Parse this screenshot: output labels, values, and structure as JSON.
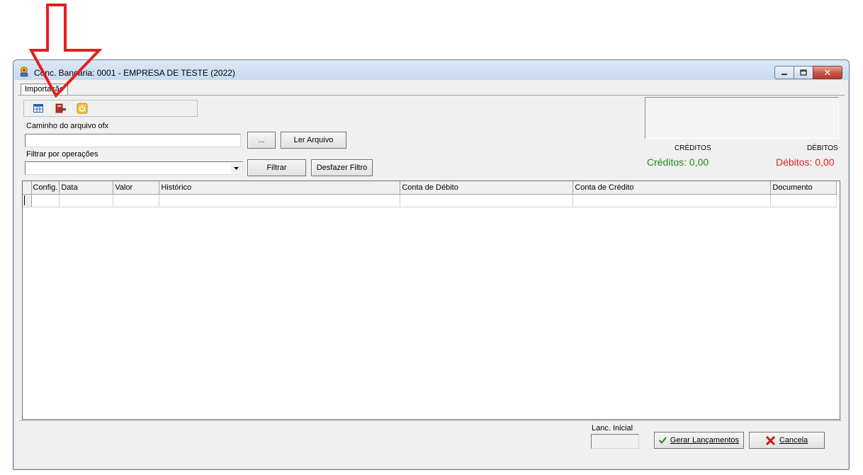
{
  "window": {
    "title": "Conc. Bancária: 0001 - EMPRESA DE TESTE (2022)",
    "controls": {
      "minimize": "minimize",
      "maximize": "maximize",
      "close": "✕"
    }
  },
  "tabs": [
    {
      "label": "Importação"
    }
  ],
  "toolbar": {
    "icons": [
      "grid-icon",
      "import-ofx-icon",
      "power-icon"
    ]
  },
  "import": {
    "path_label": "Caminho do arquivo ofx",
    "path_value": "",
    "browse_label": "...",
    "read_label": "Ler Arquivo"
  },
  "filter": {
    "label": "Filtrar por operações",
    "selected": "",
    "apply_label": "Filtrar",
    "undo_label": "Desfazer Filtro"
  },
  "summary": {
    "credits_header": "CRÉDITOS",
    "debits_header": "DÉBITOS",
    "credits_text": "Créditos: 0,00",
    "debits_text": "Débitos: 0,00",
    "credit_color": "#1b8a1b",
    "debit_color": "#e0201c"
  },
  "grid": {
    "columns": [
      "Config.",
      "Data",
      "Valor",
      "Histórico",
      "Conta de Débito",
      "Conta de Crédito",
      "Documento"
    ],
    "rows": [
      [
        "",
        "",
        "",
        "",
        "",
        "",
        ""
      ]
    ]
  },
  "footer": {
    "lanc_label": "Lanc. Inicial",
    "lanc_value": "",
    "generate_label": "Gerar Lançamentos",
    "cancel_label": "Cancela"
  },
  "annotation": {
    "arrow_color": "#e02020"
  }
}
